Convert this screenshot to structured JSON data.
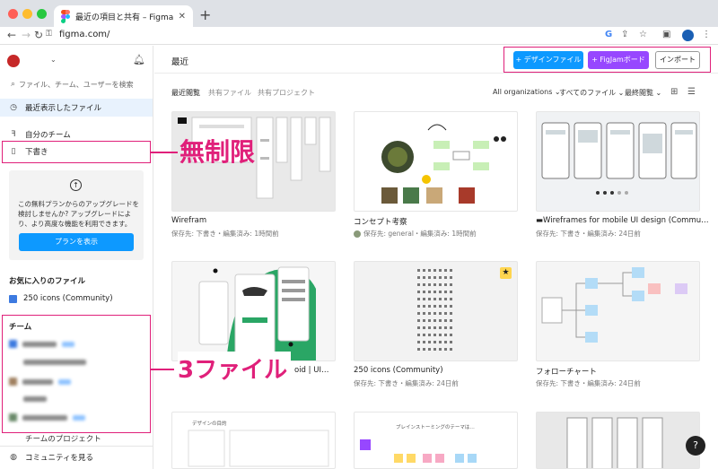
{
  "browser": {
    "tab_title": "最近の項目と共有 – Figma",
    "url": "figma.com/"
  },
  "sidebar": {
    "search_placeholder": "ファイル、チーム、ユーザーを検索",
    "recent_files": "最近表示したファイル",
    "my_teams": "自分のチーム",
    "drafts": "下書き",
    "upgrade_text": "この無料プランからのアップグレードを検討しませんか? アップグレードにより、より高度な機能を利用できます。",
    "upgrade_button": "プランを表示",
    "favorites_header": "お気に入りのファイル",
    "favorite_item": "250 icons (Community)",
    "teams_header": "チーム",
    "team_projects": "チームのプロジェクト",
    "community": "コミュニティを見る"
  },
  "header": {
    "title": "最近",
    "design_file_button": "+ デザインファイル",
    "figjam_button": "+ FigJamボード",
    "import_button": "インポート"
  },
  "subtabs": [
    "最近閲覧",
    "共有ファイル",
    "共有プロジェクト"
  ],
  "filters": {
    "org": "All organizations",
    "files": "すべてのファイル",
    "sort": "最終閲覧"
  },
  "files": [
    {
      "title": "Wirefram",
      "meta": "保存先: 下書き・編集済み: 1時間前"
    },
    {
      "title": "コンセプト考察",
      "meta": "保存先: general・編集済み: 1時間前"
    },
    {
      "title": "Wireframes for mobile UI design (Commu…",
      "meta": "保存先: 下書き・編集済み: 24日前"
    },
    {
      "title": "oid | UI…",
      "meta": ""
    },
    {
      "title": "250 icons (Community)",
      "meta": "保存先: 下書き・編集済み: 24日前"
    },
    {
      "title": "フォローチャート",
      "meta": "保存先: 下書き・編集済み: 24日前"
    }
  ],
  "thumb_text": {
    "brainstorm": "ブレインストーミングのテーマは…",
    "design_doc": "デザインの目的"
  },
  "annotations": {
    "unlimited": "無制限",
    "three_files": "3ファイル"
  },
  "help": "?",
  "colors": {
    "accent_blue": "#0d99ff",
    "figjam_purple": "#9747ff",
    "annotation_pink": "#e0207a"
  }
}
